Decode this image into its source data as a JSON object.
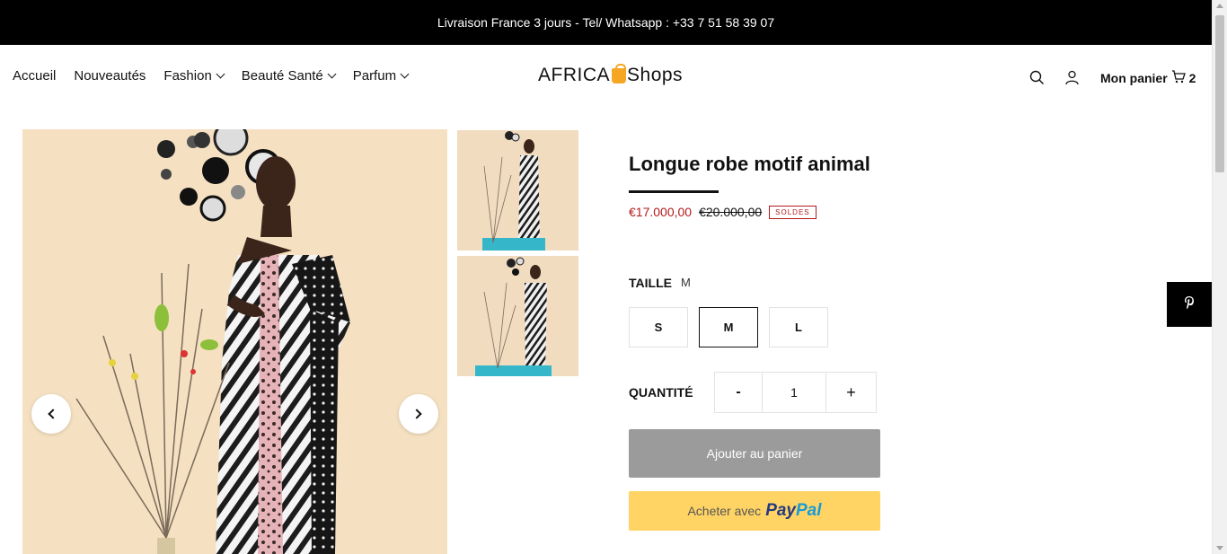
{
  "announcement": "Livraison France 3 jours - Tel/ Whatsapp : +33 7 51 58 39 07",
  "nav": {
    "items": [
      {
        "label": "Accueil"
      },
      {
        "label": "Nouveautés"
      },
      {
        "label": "Fashion"
      },
      {
        "label": "Beauté Santé"
      },
      {
        "label": "Parfum"
      }
    ]
  },
  "logo": {
    "part1": "AFRICA",
    "part2": "Shops"
  },
  "header": {
    "icons": [
      "search-icon",
      "account-icon",
      "cart-icon"
    ],
    "cart_label": "Mon panier",
    "cart_count": "2"
  },
  "product": {
    "title": "Longue robe motif animal",
    "sale_price": "€17.000,00",
    "old_price": "€20.000,00",
    "badge": "SOLDES",
    "size_label": "TAILLE",
    "selected_size": "M",
    "sizes": [
      "S",
      "M",
      "L"
    ],
    "quantity_label": "QUANTITÉ",
    "quantity_minus": "-",
    "quantity": "1",
    "quantity_plus": "+",
    "add_to_cart": "Ajouter au panier",
    "paypal_prefix": "Acheter avec",
    "paypal_brand_1": "Pay",
    "paypal_brand_2": "Pal"
  },
  "colors": {
    "announcement_bg": "#000000",
    "sale": "#b11a1a",
    "add_to_cart_bg": "#9b9b9b",
    "paypal_bg": "#ffd464",
    "logo_accent": "#f5a623"
  }
}
